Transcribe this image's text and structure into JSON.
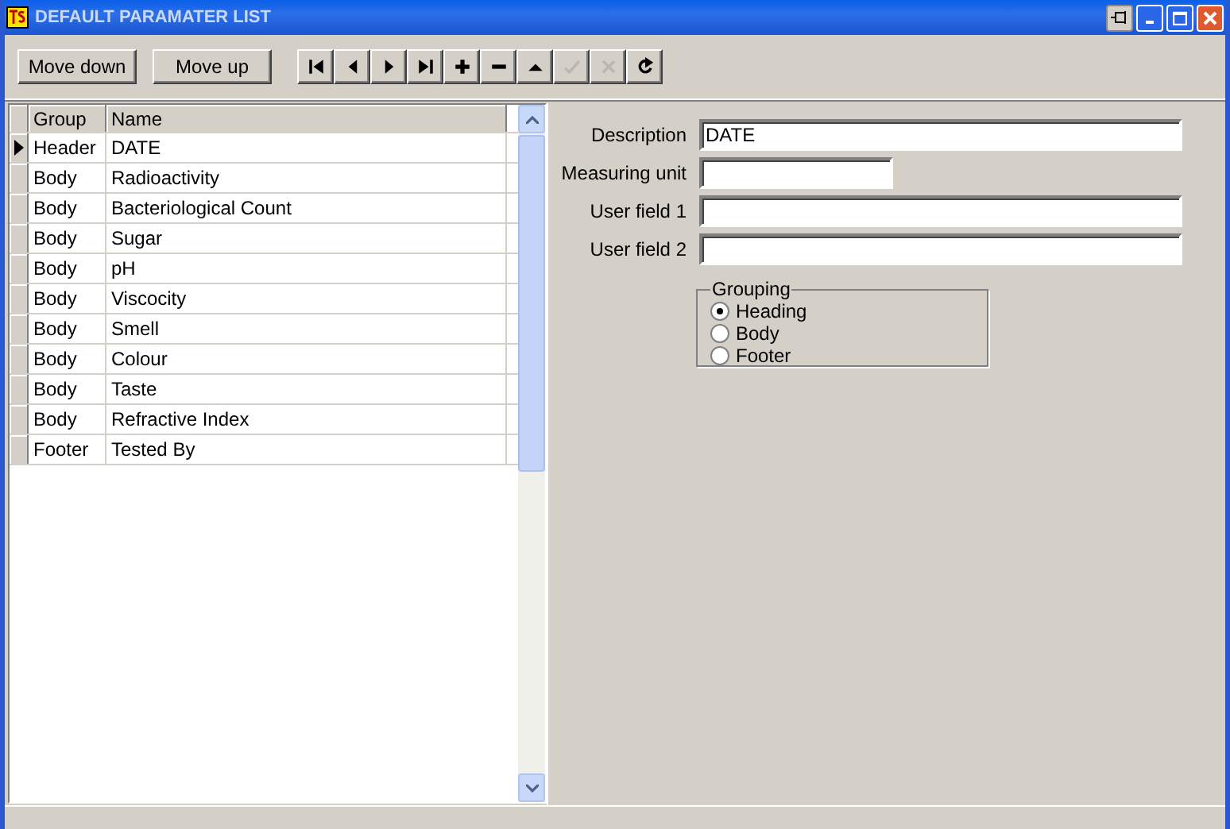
{
  "window": {
    "title": "DEFAULT PARAMATER LIST"
  },
  "toolbar": {
    "buttons": [
      "Move down",
      "Move up"
    ],
    "navigator": [
      {
        "kind": "first",
        "disabled": false
      },
      {
        "kind": "prior",
        "disabled": false
      },
      {
        "kind": "next",
        "disabled": false
      },
      {
        "kind": "last",
        "disabled": false
      },
      {
        "kind": "insert",
        "disabled": false
      },
      {
        "kind": "delete",
        "disabled": false
      },
      {
        "kind": "edit",
        "disabled": false
      },
      {
        "kind": "post",
        "disabled": true
      },
      {
        "kind": "cancel",
        "disabled": true
      },
      {
        "kind": "refresh",
        "disabled": false
      }
    ]
  },
  "table": {
    "columns": [
      "Group",
      "Name"
    ],
    "rows": [
      {
        "group": "Header",
        "name": "DATE",
        "selected": true
      },
      {
        "group": "Body",
        "name": "Radioactivity",
        "selected": false
      },
      {
        "group": "Body",
        "name": "Bacteriological Count",
        "selected": false
      },
      {
        "group": "Body",
        "name": "Sugar",
        "selected": false
      },
      {
        "group": "Body",
        "name": "pH",
        "selected": false
      },
      {
        "group": "Body",
        "name": "Viscocity",
        "selected": false
      },
      {
        "group": "Body",
        "name": "Smell",
        "selected": false
      },
      {
        "group": "Body",
        "name": "Colour",
        "selected": false
      },
      {
        "group": "Body",
        "name": "Taste",
        "selected": false
      },
      {
        "group": "Body",
        "name": "Refractive Index",
        "selected": false
      },
      {
        "group": "Footer",
        "name": "Tested By",
        "selected": false
      }
    ]
  },
  "form": {
    "fields": [
      {
        "label": "Description",
        "value": "DATE",
        "kind": "wide"
      },
      {
        "label": "Measuring unit",
        "kind": "short"
      },
      {
        "label": "User field 1",
        "kind": "wide"
      },
      {
        "label": "User field 2",
        "kind": "wide"
      }
    ],
    "grouping": {
      "title": "Grouping",
      "options": [
        {
          "label": "Heading",
          "selected": true
        },
        {
          "label": "Body",
          "selected": false
        },
        {
          "label": "Footer",
          "selected": false
        }
      ]
    }
  }
}
